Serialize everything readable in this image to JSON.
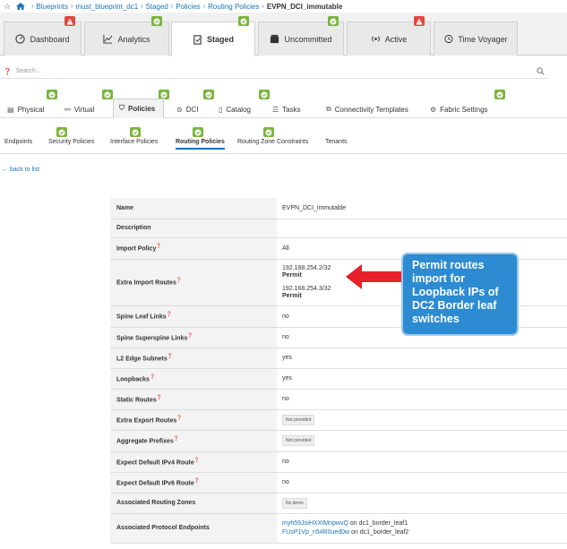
{
  "breadcrumb": {
    "items": [
      "Blueprints",
      "must_blueprint_dc1",
      "Staged",
      "Policies",
      "Routing Policies"
    ],
    "current": "EVPN_DCI_immutable"
  },
  "top_tabs": [
    {
      "label": "Dashboard",
      "icon": "dashboard-icon",
      "badge": "warn"
    },
    {
      "label": "Analytics",
      "icon": "analytics-icon",
      "badge": "ok"
    },
    {
      "label": "Staged",
      "icon": "staged-icon",
      "badge": "ok",
      "active": true
    },
    {
      "label": "Uncommitted",
      "icon": "uncommitted-icon",
      "badge": "ok"
    },
    {
      "label": "Active",
      "icon": "active-icon",
      "badge": "warn"
    },
    {
      "label": "Time Voyager",
      "icon": "time-voyager-icon"
    }
  ],
  "search": {
    "placeholder": "Search..."
  },
  "second_tabs": [
    "Physical",
    "Virtual",
    "Policies",
    "DCI",
    "Catalog",
    "Tasks",
    "Connectivity Templates",
    "Fabric Settings"
  ],
  "third_tabs": [
    "Endpoints",
    "Security Policies",
    "Interface Policies",
    "Routing Policies",
    "Routing Zone Constraints",
    "Tenants"
  ],
  "back_link": "back to list",
  "details": {
    "name_label": "Name",
    "name_value": "EVPN_DCI_immutable",
    "description_label": "Description",
    "import_policy_label": "Import Policy",
    "import_policy_value": "All",
    "extra_import_label": "Extra Import Routes",
    "extra_import_routes": [
      {
        "prefix": "192.168.254.2/32",
        "action": "Permit"
      },
      {
        "prefix": "192.168.254.3/32",
        "action": "Permit"
      }
    ],
    "spine_leaf_label": "Spine Leaf Links",
    "spine_leaf_value": "no",
    "spine_superspine_label": "Spine Superspine Links",
    "spine_superspine_value": "no",
    "l2_edge_label": "L2 Edge Subnets",
    "l2_edge_value": "yes",
    "loopbacks_label": "Loopbacks",
    "loopbacks_value": "yes",
    "static_routes_label": "Static Routes",
    "static_routes_value": "no",
    "extra_export_label": "Extra Export Routes",
    "extra_export_value": "Not provided",
    "aggregate_label": "Aggregate Prefixes",
    "aggregate_value": "Not provided",
    "default_v4_label": "Expect Default IPv4 Route",
    "default_v4_value": "no",
    "default_v6_label": "Expect Default IPv6 Route",
    "default_v6_value": "no",
    "assoc_zones_label": "Associated Routing Zones",
    "assoc_zones_value": "No items",
    "assoc_endpoints_label": "Associated Protocol Endpoints",
    "assoc_endpoints": [
      {
        "id": "myh59JoiHXXtMnpwvQ",
        "on": "on dc1_border_leaf1"
      },
      {
        "id": "FUsP1Vp_n54R0ued0w",
        "on": "on dc1_border_leaf2"
      }
    ]
  },
  "callout": {
    "text": "Permit routes import for Loopback IPs of DC2 Border leaf switches"
  },
  "colors": {
    "accent": "#1c73b8",
    "ok": "#79b53b",
    "warn": "#e0473f",
    "callout": "#2d8bd2",
    "arrow": "#e8202a"
  }
}
